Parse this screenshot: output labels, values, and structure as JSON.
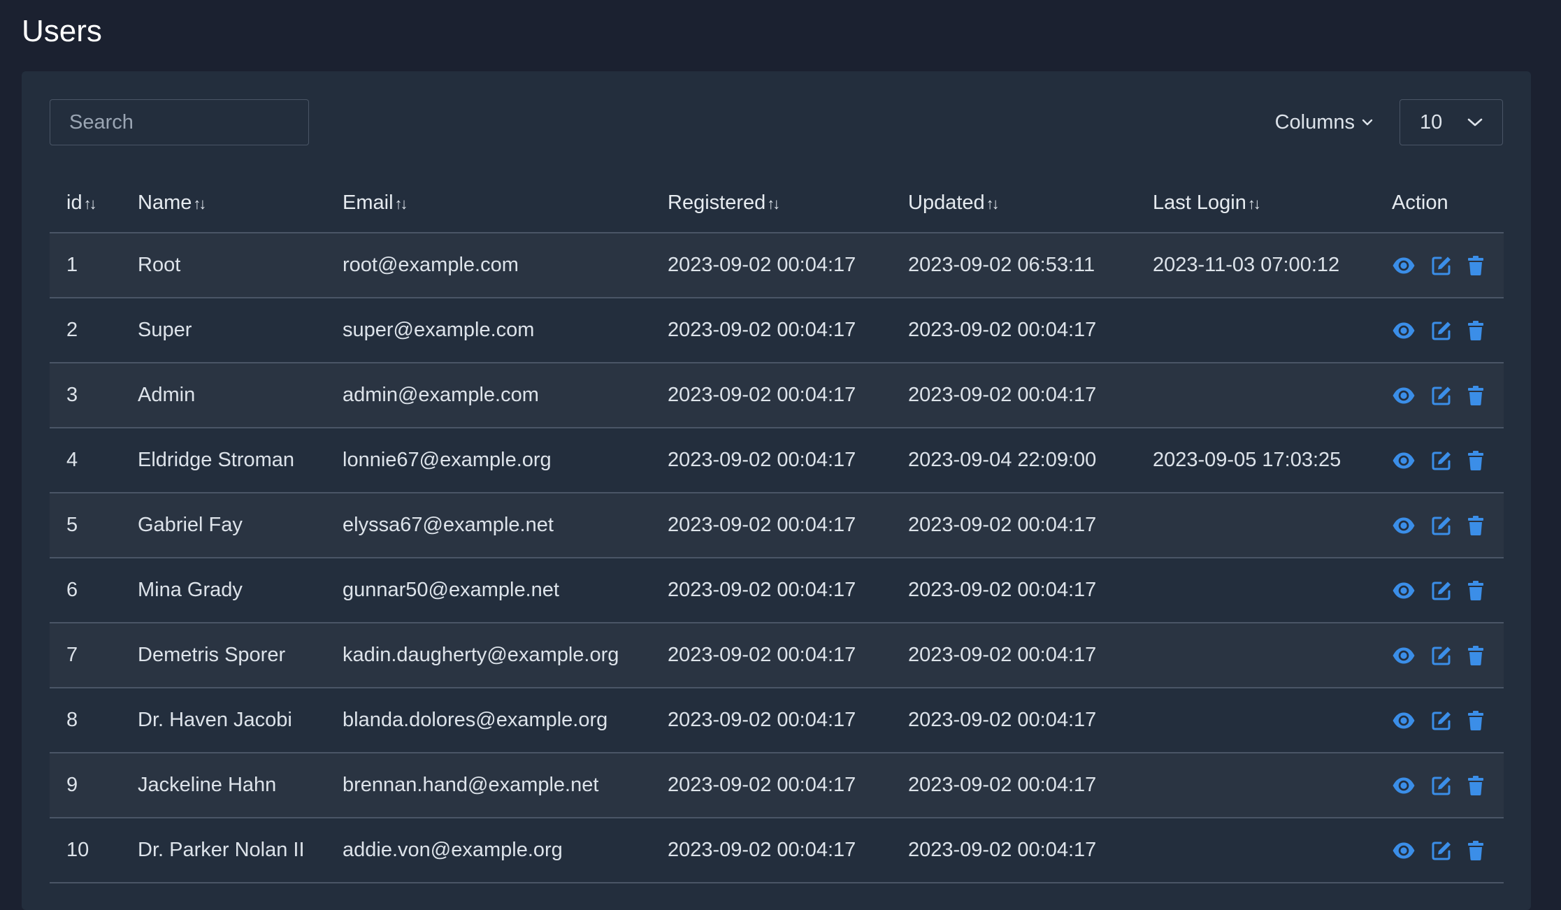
{
  "page": {
    "title": "Users"
  },
  "toolbar": {
    "search_placeholder": "Search",
    "columns_label": "Columns",
    "page_size": "10"
  },
  "colors": {
    "accent": "#3b8ee8",
    "background": "#1b2130",
    "panel": "#232e3d"
  },
  "icons": {
    "view": "eye-icon",
    "edit": "edit-icon",
    "delete": "trash-icon",
    "sort": "sort-icon"
  },
  "table": {
    "headers": {
      "id": "id",
      "name": "Name",
      "email": "Email",
      "registered": "Registered",
      "updated": "Updated",
      "last_login": "Last Login",
      "action": "Action"
    },
    "sort_symbol": "↑↓",
    "rows": [
      {
        "id": "1",
        "name": "Root",
        "email": "root@example.com",
        "registered": "2023-09-02 00:04:17",
        "updated": "2023-09-02 06:53:11",
        "last_login": "2023-11-03 07:00:12"
      },
      {
        "id": "2",
        "name": "Super",
        "email": "super@example.com",
        "registered": "2023-09-02 00:04:17",
        "updated": "2023-09-02 00:04:17",
        "last_login": ""
      },
      {
        "id": "3",
        "name": "Admin",
        "email": "admin@example.com",
        "registered": "2023-09-02 00:04:17",
        "updated": "2023-09-02 00:04:17",
        "last_login": ""
      },
      {
        "id": "4",
        "name": "Eldridge Stroman",
        "email": "lonnie67@example.org",
        "registered": "2023-09-02 00:04:17",
        "updated": "2023-09-04 22:09:00",
        "last_login": "2023-09-05 17:03:25"
      },
      {
        "id": "5",
        "name": "Gabriel Fay",
        "email": "elyssa67@example.net",
        "registered": "2023-09-02 00:04:17",
        "updated": "2023-09-02 00:04:17",
        "last_login": ""
      },
      {
        "id": "6",
        "name": "Mina Grady",
        "email": "gunnar50@example.net",
        "registered": "2023-09-02 00:04:17",
        "updated": "2023-09-02 00:04:17",
        "last_login": ""
      },
      {
        "id": "7",
        "name": "Demetris Sporer",
        "email": "kadin.daugherty@example.org",
        "registered": "2023-09-02 00:04:17",
        "updated": "2023-09-02 00:04:17",
        "last_login": ""
      },
      {
        "id": "8",
        "name": "Dr. Haven Jacobi",
        "email": "blanda.dolores@example.org",
        "registered": "2023-09-02 00:04:17",
        "updated": "2023-09-02 00:04:17",
        "last_login": ""
      },
      {
        "id": "9",
        "name": "Jackeline Hahn",
        "email": "brennan.hand@example.net",
        "registered": "2023-09-02 00:04:17",
        "updated": "2023-09-02 00:04:17",
        "last_login": ""
      },
      {
        "id": "10",
        "name": "Dr. Parker Nolan II",
        "email": "addie.von@example.org",
        "registered": "2023-09-02 00:04:17",
        "updated": "2023-09-02 00:04:17",
        "last_login": ""
      }
    ]
  }
}
